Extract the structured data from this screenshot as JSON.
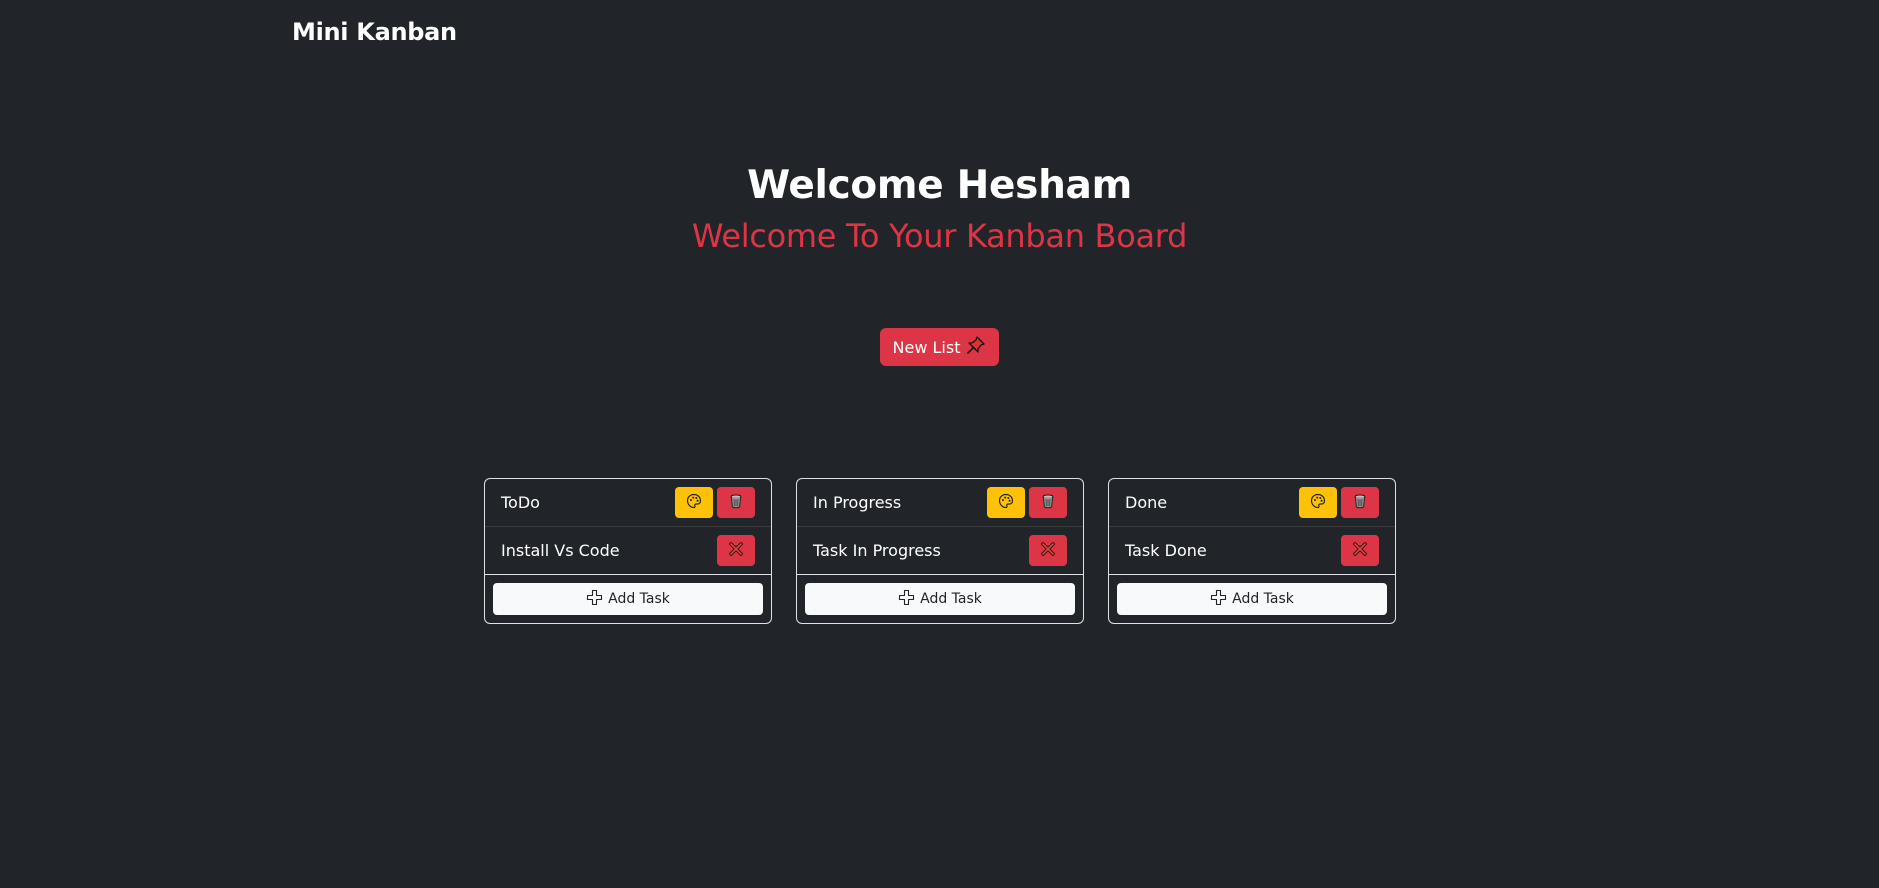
{
  "navbar": {
    "brand": "Mini Kanban"
  },
  "hero": {
    "title": "Welcome Hesham",
    "subtitle": "Welcome To Your Kanban Board"
  },
  "new_list_button": {
    "label": "New List",
    "icon": "pushpin-icon"
  },
  "colors": {
    "background": "#212529",
    "danger": "#dc3545",
    "warning": "#ffc107",
    "light": "#f8f9fa"
  },
  "lists": [
    {
      "title": "ToDo",
      "tasks": [
        "Install Vs Code"
      ],
      "add_label": "Add Task"
    },
    {
      "title": "In Progress",
      "tasks": [
        "Task In Progress"
      ],
      "add_label": "Add Task"
    },
    {
      "title": "Done",
      "tasks": [
        "Task Done"
      ],
      "add_label": "Add Task"
    }
  ]
}
